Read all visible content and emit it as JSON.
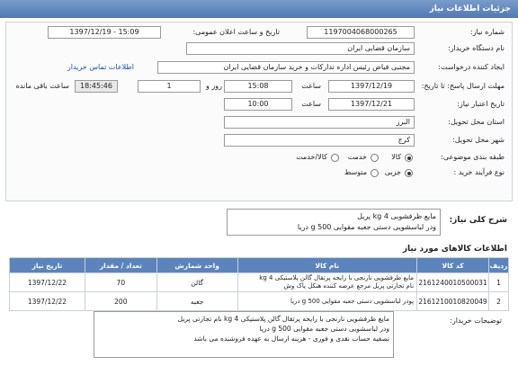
{
  "header": {
    "title": "جزئیات اطلاعات نیاز"
  },
  "form": {
    "need_number_label": "شماره نیاز:",
    "need_number_value": "1197004068000265",
    "announce_label": "تاریخ و ساعت اعلان عمومی:",
    "announce_value": "1397/12/19 - 15:09",
    "buyer_label": "نام دستگاه خریدار:",
    "buyer_value": "سازمان قضایی ایران",
    "creator_label": "ایجاد کننده درخواست:",
    "creator_value": "مجتبی  فیاض رئیس اداره تدارکات و خرید سازمان قضایی ایران",
    "contact_link": "اطلاعات تماس خریدار",
    "deadline_label": "مهلت ارسال پاسخ: تا تاریخ:",
    "deadline_date": "1397/12/19",
    "deadline_time_label": "ساعت",
    "deadline_time": "15:08",
    "remaining_days": "1",
    "days_label": "روز و",
    "remaining_time": "18:45:46",
    "remaining_label": "ساعت باقی مانده",
    "validity_label": "تاریخ اعتبار نیاز:",
    "validity_date": "1397/12/21",
    "validity_time_label": "ساعت",
    "validity_time": "10:00",
    "province_label": "استان محل تحویل:",
    "province_value": "البرز",
    "city_label": "شهر محل تحویل:",
    "city_value": "کرج",
    "category_label": "طبقه بندی موضوعی:",
    "category_options": [
      "کالا",
      "خدمت",
      "کالا/خدمت"
    ],
    "category_selected": 0,
    "purchase_label": "نوع فرآیند خرید :",
    "purchase_options": [
      "جزیی",
      "متوسط"
    ],
    "purchase_selected": 0
  },
  "description": {
    "label": "شرح کلی نیاز:",
    "line1": "مایع ظرفشویی 4 kg  پریل",
    "line2": "ودر لباسشویی دستی جعبه مقوایی 500 g دریا"
  },
  "items_section": {
    "title": "اطلاعات کالاهای مورد نیاز"
  },
  "table": {
    "headers": [
      "ردیف",
      "کد کالا",
      "نام کالا",
      "واحد شمارش",
      "تعداد / مقدار",
      "تاریخ نیاز"
    ],
    "rows": [
      {
        "idx": "1",
        "code": "2161240010500031",
        "name1": "مایع ظرفشویی نارنجی با رایحه پرتقال گالن پلاستیکی 4 kg",
        "name2": "نام تجارتی پریل مرجع عرضه کننده هنکل پاک وش",
        "unit": "گالن",
        "qty": "70",
        "date": "1397/12/22"
      },
      {
        "idx": "2",
        "code": "2161210010820049",
        "name1": "پودر لباسشویی دستی جعبه مقوایی 500 g دریا",
        "name2": "",
        "unit": "جعبه",
        "qty": "200",
        "date": "1397/12/22"
      }
    ]
  },
  "notes": {
    "label": "توضیحات خریدار:",
    "line1": "مایع ظرفشویی نارنجی با رایحه پرتقال گالن پلاستیکی 4 kg نام تجارتی پریل",
    "line2": "ودر لباسشویی دستی جعبه مقوایی 500 g دریا",
    "line3": "تصفیه حساب نقدی و فوری - هزینه ارسال به عهده فروشنده می باشد"
  }
}
